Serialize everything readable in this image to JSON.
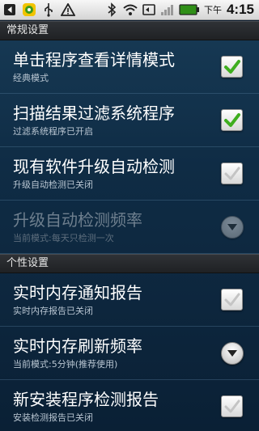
{
  "statusbar": {
    "time": "4:15",
    "ampm": "下午",
    "icons": [
      "back-arrow-icon",
      "app-icon",
      "usb-icon",
      "warning-icon",
      "bluetooth-icon",
      "wifi-icon",
      "sync-icon",
      "signal-icon",
      "battery-icon"
    ]
  },
  "sections": [
    {
      "header": "常规设置",
      "items": [
        {
          "title": "单击程序查看详情模式",
          "summary": "经典模式",
          "control": "checkbox",
          "checked": true,
          "enabled": true
        },
        {
          "title": "扫描结果过滤系统程序",
          "summary": "过滤系统程序已开启",
          "control": "checkbox",
          "checked": true,
          "enabled": true
        },
        {
          "title": "现有软件升级自动检测",
          "summary": "升级自动检测已关闭",
          "control": "checkbox",
          "checked": false,
          "enabled": true
        },
        {
          "title": "升级自动检测频率",
          "summary": "当前模式:每天只检测一次",
          "control": "spinner",
          "enabled": false
        }
      ]
    },
    {
      "header": "个性设置",
      "items": [
        {
          "title": "实时内存通知报告",
          "summary": "实时内存报告已关闭",
          "control": "checkbox",
          "checked": false,
          "enabled": true
        },
        {
          "title": "实时内存刷新频率",
          "summary": "当前模式:5分钟(推荐使用)",
          "control": "spinner",
          "enabled": true
        },
        {
          "title": "新安装程序检测报告",
          "summary": "安装检测报告已关闭",
          "control": "checkbox",
          "checked": false,
          "enabled": true
        }
      ]
    }
  ],
  "colors": {
    "check_green": "#3fae1f",
    "check_grey": "#c4c4c4",
    "section_bg": "#26292d",
    "content_bg": "#143350"
  }
}
